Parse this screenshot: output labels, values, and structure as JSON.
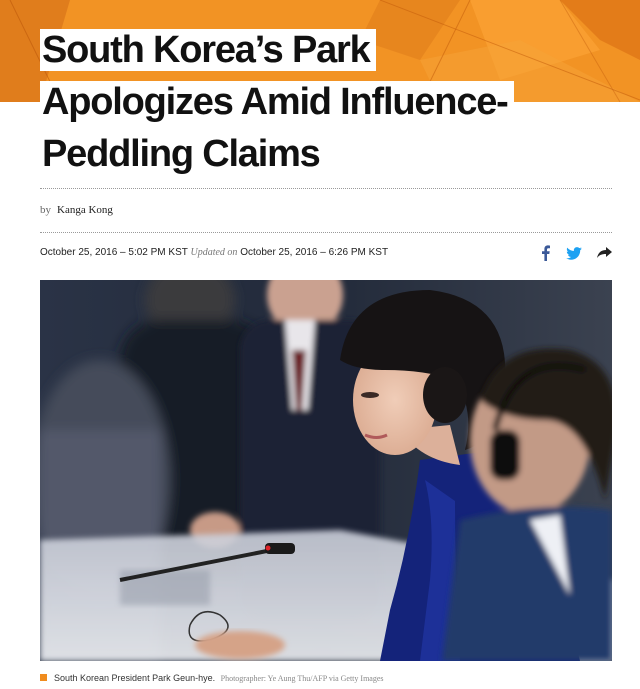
{
  "headline": {
    "line1": "South Korea’s Park",
    "line2": "Apologizes Amid Influence-",
    "line3": "Peddling Claims"
  },
  "byline": {
    "prefix": "by",
    "author": "Kanga Kong"
  },
  "meta": {
    "published": "October 25, 2016 – 5:02 PM KST",
    "updated_label": "Updated on",
    "updated": "October 25, 2016 – 6:26 PM KST"
  },
  "share": {
    "icons": [
      "facebook-icon",
      "twitter-icon",
      "share-arrow-icon"
    ],
    "colors": {
      "facebook": "#3b5998",
      "twitter": "#1da1f2",
      "share": "#222222"
    }
  },
  "caption": {
    "text": "South Korean President Park Geun-hye.",
    "credit": "Photographer: Ye Aung Thu/AFP via Getty Images"
  },
  "colors": {
    "accent": "#f08c1e",
    "banner_dark": "#c45f0c"
  }
}
